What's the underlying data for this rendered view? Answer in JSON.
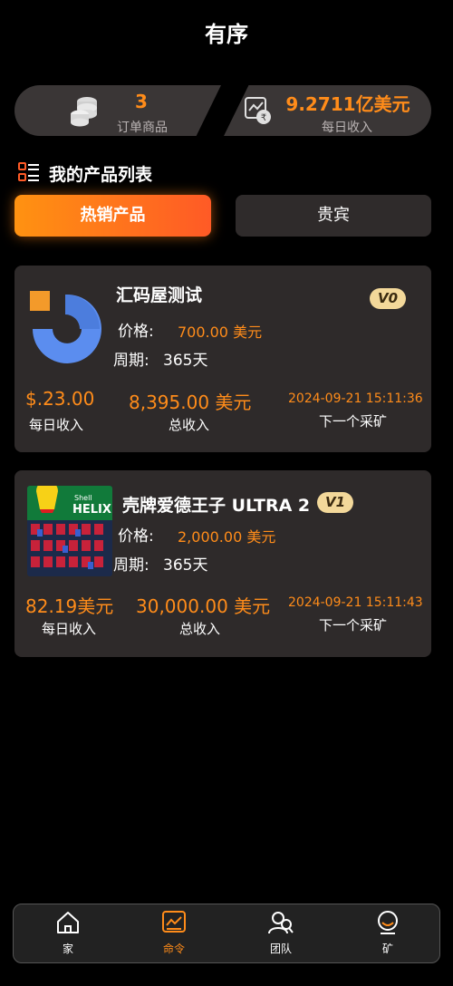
{
  "header": {
    "title": "有序"
  },
  "stats": {
    "orders": {
      "value": "3",
      "label": "订单商品",
      "icon": "coins-icon"
    },
    "daily": {
      "value": "9.2711亿美元",
      "label": "每日收入",
      "icon": "chart-money-icon"
    }
  },
  "section": {
    "title": "我的产品列表",
    "icon": "list-icon"
  },
  "tabs": [
    {
      "label": "热销产品",
      "active": true
    },
    {
      "label": "贵宾",
      "active": false
    }
  ],
  "products": [
    {
      "name": "汇码屋测试",
      "badge": "V0",
      "price_label": "价格:",
      "price": "700.00 美元",
      "period_label": "周期:",
      "period": "365天",
      "daily_income": "$.23.00",
      "daily_income_label": "每日收入",
      "total_income": "8,395.00 美元",
      "total_income_label": "总收入",
      "next_time": "2024-09-21 15:11:36",
      "next_label": "下一个采矿"
    },
    {
      "name": "壳牌爱德王子 ULTRA 2",
      "badge": "V1",
      "price_label": "价格:",
      "price": "2,000.00 美元",
      "period_label": "周期:",
      "period": "365天",
      "daily_income": "82.19美元",
      "daily_income_label": "每日收入",
      "total_income": "30,000.00 美元",
      "total_income_label": "总收入",
      "next_time": "2024-09-21 15:11:43",
      "next_label": "下一个采矿",
      "image_text": {
        "brand": "Shell",
        "product": "HELIX"
      }
    }
  ],
  "nav": [
    {
      "label": "家",
      "icon": "home-icon"
    },
    {
      "label": "命令",
      "icon": "orders-chart-icon",
      "active": true
    },
    {
      "label": "团队",
      "icon": "team-icon"
    },
    {
      "label": "矿",
      "icon": "user-mine-icon"
    }
  ],
  "colors": {
    "accent": "#ff8c1a",
    "card": "#2e2a2a",
    "badge": "#f3d89a"
  }
}
